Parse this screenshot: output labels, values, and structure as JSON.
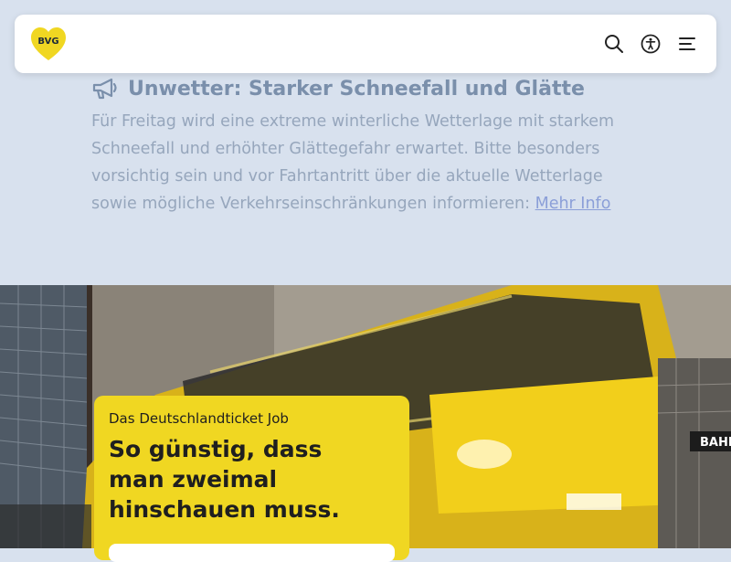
{
  "header": {
    "logo_text": "BVG",
    "icons": [
      "search-icon",
      "accessibility-icon",
      "menu-icon"
    ]
  },
  "alert": {
    "icon": "megaphone-icon",
    "title": "Unwetter: Starker Schneefall und Glätte",
    "body": "Für Freitag wird eine extreme winterliche Wetterlage mit starkem Schneefall und erhöhter Glättegefahr erwartet. Bitte besonders vorsichtig sein und vor Fahrtantritt über die aktuelle Wetterlage sowie mögliche Verkehrseinschränkungen informieren: ",
    "link": "Mehr Info"
  },
  "hero": {
    "sign_text": "BAHN"
  },
  "promo": {
    "kicker": "Das Deutschlandticket Job",
    "headline": "So günstig, dass man zweimal hinschauen muss."
  },
  "colors": {
    "brand_yellow": "#f0d722",
    "page_bg": "#d8e1ee",
    "alert_title": "#7a8fab",
    "alert_text": "#96a6bc",
    "link": "#8b9fd8"
  }
}
